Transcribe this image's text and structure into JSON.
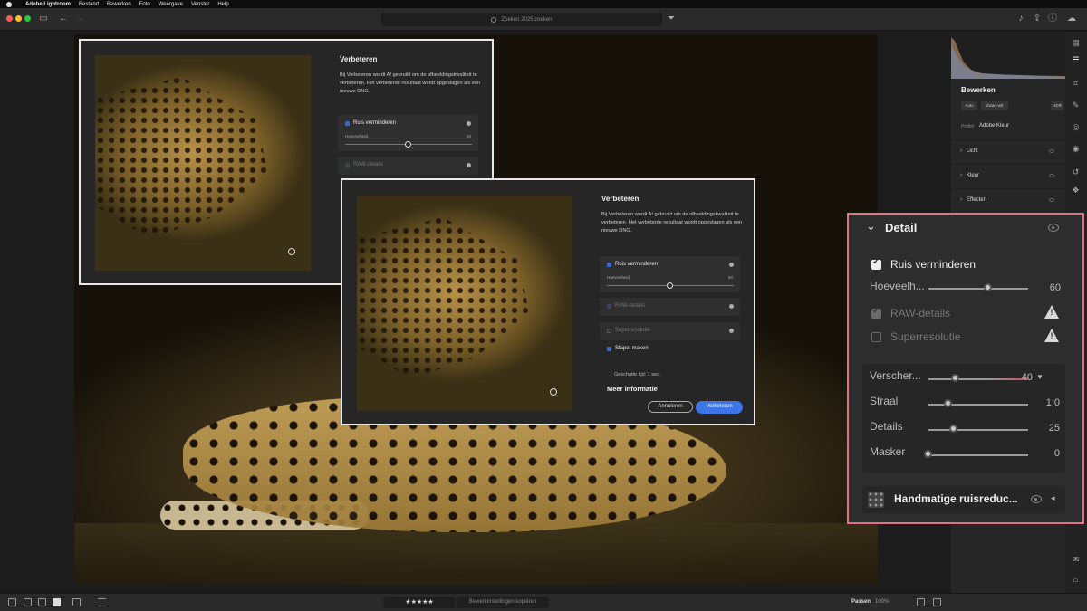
{
  "menubar": {
    "app_name": "Adobe Lightroom",
    "items": [
      "Bestand",
      "Bewerken",
      "Foto",
      "Weergave",
      "Venster",
      "Help"
    ]
  },
  "toolbar": {
    "search_placeholder": "Zoeken 2025 zoeken"
  },
  "enhance_dialog": {
    "title": "Verbeteren",
    "description": "Bij Verbeteren wordt AI gebruikt om de afbeeldingskwaliteit te verbeteren. Het verbeterde resultaat wordt opgeslagen als een nieuwe DNG.",
    "noise_label": "Ruis verminderen",
    "amount_label": "Hoeveelheid",
    "amount_value": "50",
    "amount_fraction": 0.5,
    "raw_label": "RAW-details",
    "super_label": "Superresolutie",
    "stack_label": "Stapel maken",
    "estimated_time": "Geschatte tijd: 1 sec.",
    "more_info": "Meer informatie",
    "cancel_label": "Annuleren",
    "enhance_label": "Verbeteren"
  },
  "right_panel": {
    "title": "Bewerken",
    "chips": [
      "Auto",
      "Zwart-wit",
      "HDR"
    ],
    "profile_label": "Profiel",
    "profile_value": "Adobe Kleur",
    "sections": [
      "Licht",
      "Kleur",
      "Effecten"
    ]
  },
  "detail_panel": {
    "title": "Detail",
    "noise_label": "Ruis verminderen",
    "amount_label": "Hoeveelh...",
    "amount_value": "60",
    "amount_fraction": 0.6,
    "raw_label": "RAW-details",
    "super_label": "Superresolutie",
    "sharpen": [
      {
        "label": "Verscher...",
        "value": "40",
        "fraction": 0.27
      },
      {
        "label": "Straal",
        "value": "1,0",
        "fraction": 0.2
      },
      {
        "label": "Details",
        "value": "25",
        "fraction": 0.25
      },
      {
        "label": "Masker",
        "value": "0",
        "fraction": 0.0
      }
    ],
    "manual_label": "Handmatige ruisreduc..."
  },
  "bottombar": {
    "copy_label": "Bewerkinstellingen kopiëren",
    "stars": "★★★★★",
    "fit_label": "Passen",
    "zoom": "100%"
  },
  "colors": {
    "accent": "#3d74e8",
    "callout_border": "#e0737f"
  }
}
